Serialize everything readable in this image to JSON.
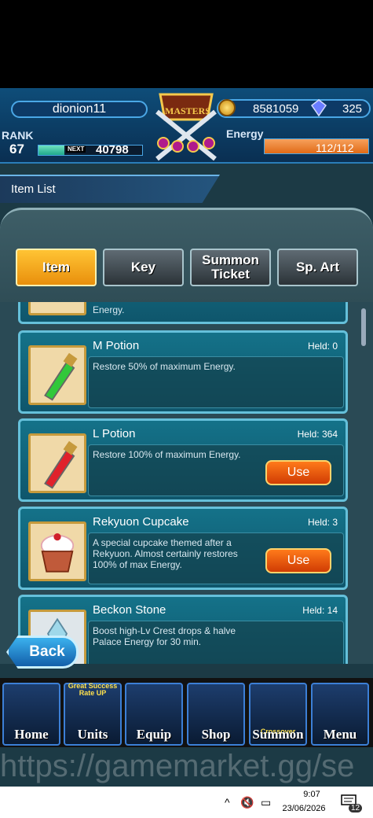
{
  "header": {
    "username": "dionion11",
    "rank_label": "RANK",
    "rank_value": "67",
    "next_label": "NEXT",
    "exp_to_next": "40798",
    "exp_progress": 0.25,
    "gold": "8581059",
    "gems": "325",
    "energy_label": "Energy",
    "energy_value": "112/112",
    "energy_progress": 1.0,
    "emblem_text": "MASTERS"
  },
  "page": {
    "title": "Item List"
  },
  "tabs": [
    {
      "label": "Item",
      "active": true
    },
    {
      "label": "Key",
      "active": false
    },
    {
      "label": "Summon Ticket",
      "active": false
    },
    {
      "label": "Sp. Art",
      "active": false
    }
  ],
  "items": [
    {
      "name": "",
      "held": "",
      "desc": "Energy."
    },
    {
      "name": "M Potion",
      "held": "Held: 0",
      "desc": "Restore 50% of maximum Energy.",
      "icon": "green-potion-icon"
    },
    {
      "name": "L Potion",
      "held": "Held: 364",
      "desc": "Restore 100% of maximum Energy.",
      "icon": "red-potion-icon",
      "button": "Use"
    },
    {
      "name": "Rekyuon Cupcake",
      "held": "Held: 3",
      "desc": "A special cupcake themed after a Rekyuon. Almost certainly restores 100% of max Energy.",
      "icon": "cupcake-icon",
      "button": "Use"
    },
    {
      "name": "Beckon Stone",
      "held": "Held: 14",
      "desc": "Boost high-Lv Crest drops & halve Palace Energy for 30 min.",
      "icon": "crystal-icon"
    }
  ],
  "back_label": "Back",
  "nav": [
    {
      "label": "Home",
      "badge": ""
    },
    {
      "label": "Units",
      "badge": "Great Success Rate UP"
    },
    {
      "label": "Equip",
      "badge": ""
    },
    {
      "label": "Shop",
      "badge": ""
    },
    {
      "label": "Summon",
      "badge": "Crossover"
    },
    {
      "label": "Menu",
      "badge": ""
    }
  ],
  "watermark": "https://gamemarket.gg/se",
  "taskbar": {
    "time": "9:07",
    "date": "23/06/2026",
    "notifications": "12"
  },
  "colors": {
    "accent_orange": "#ff7a1a",
    "card_teal": "#147289",
    "tab_active": "#ffc434"
  }
}
